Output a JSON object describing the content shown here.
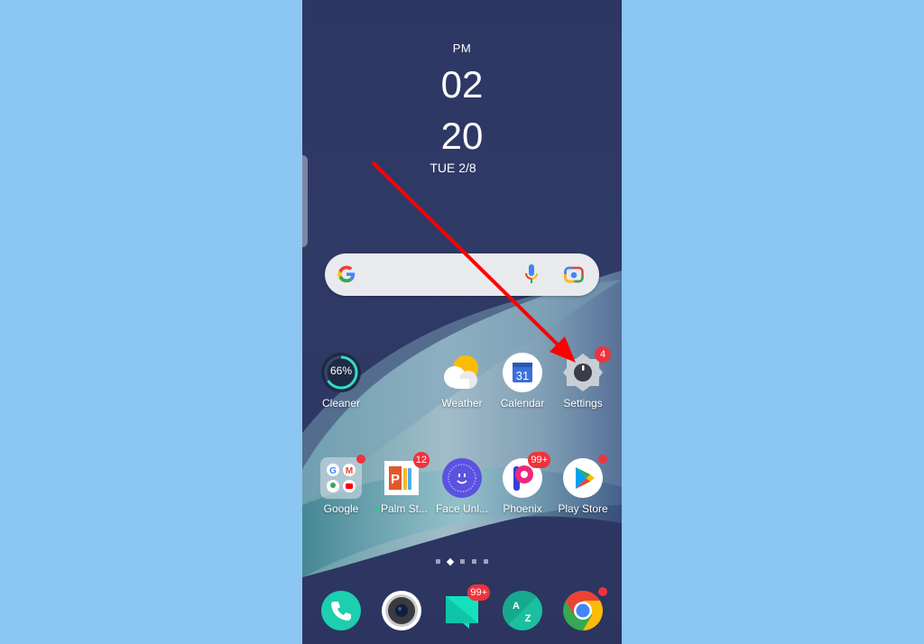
{
  "clock": {
    "ampm": "PM",
    "hour": "02",
    "minute": "20",
    "date": "TUE 2/8"
  },
  "search_widget": {
    "logo": "google-g-icon",
    "mic": "microphone-icon",
    "lens": "google-lens-icon"
  },
  "row1": [
    {
      "label": "Cleaner",
      "icon": "cleaner-gauge-icon",
      "value": "66%"
    },
    {
      "label": "Weather",
      "icon": "weather-icon"
    },
    {
      "label": "Calendar",
      "icon": "calendar-icon",
      "day": "31"
    },
    {
      "label": "Settings",
      "icon": "settings-gear-icon",
      "badge": "4"
    }
  ],
  "row2": [
    {
      "label": "Google",
      "icon": "google-folder-icon",
      "dot": true
    },
    {
      "label": "Palm St...",
      "icon": "palm-store-icon",
      "badge": "12",
      "new_indicator": true
    },
    {
      "label": "Face Unl...",
      "icon": "face-unlock-icon"
    },
    {
      "label": "Phoenix",
      "icon": "phoenix-icon",
      "badge": "99+"
    },
    {
      "label": "Play Store",
      "icon": "play-store-icon",
      "dot": true
    }
  ],
  "page_indicator": {
    "total": 5,
    "active_index": 1
  },
  "dock": [
    {
      "icon": "phone-icon"
    },
    {
      "icon": "camera-icon"
    },
    {
      "icon": "messages-icon",
      "badge": "99+"
    },
    {
      "icon": "a-z-contacts-icon",
      "letters": [
        "A",
        "Z"
      ]
    },
    {
      "icon": "chrome-icon",
      "dot": true
    }
  ],
  "annotation": {
    "type": "red-arrow",
    "points_to": "Settings",
    "color": "#ff0000"
  },
  "colors": {
    "background": "#8cc6f2",
    "badge": "#f0323c",
    "accent_teal": "#1ccfae"
  }
}
